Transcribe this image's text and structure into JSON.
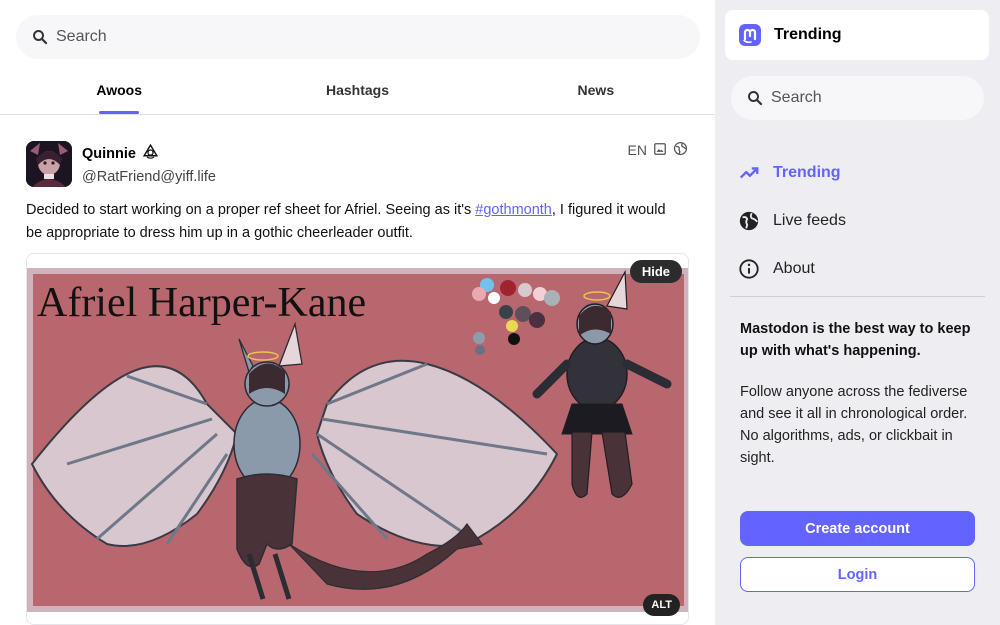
{
  "search": {
    "placeholder": "Search"
  },
  "tabs": [
    {
      "label": "Awoos",
      "active": true
    },
    {
      "label": "Hashtags",
      "active": false
    },
    {
      "label": "News",
      "active": false
    }
  ],
  "post": {
    "display_name": "Quinnie",
    "handle": "@RatFriend@yiff.life",
    "language": "EN",
    "text_before": "Decided to start working on a proper ref sheet for Afriel. Seeing as it's ",
    "hashtag": "#gothmonth",
    "text_after": ", I figured it would be appropriate to dress him up in a gothic cheerleader outfit.",
    "media": {
      "title_text": "Afriel Harper-Kane",
      "hide_label": "Hide",
      "alt_label": "ALT"
    }
  },
  "sidebar": {
    "brand_title": "Trending",
    "search_placeholder": "Search",
    "nav": [
      {
        "label": "Trending",
        "icon": "trending-icon",
        "active": true
      },
      {
        "label": "Live feeds",
        "icon": "globe-icon",
        "active": false
      },
      {
        "label": "About",
        "icon": "info-icon",
        "active": false
      }
    ],
    "pitch_strong": "Mastodon is the best way to keep up with what's happening.",
    "pitch": "Follow anyone across the fediverse and see it all in chronological order. No algorithms, ads, or clickbait in sight.",
    "create_account_label": "Create account",
    "login_label": "Login"
  },
  "colors": {
    "accent": "#6364ff",
    "sidebar_bg": "#eeeef2",
    "artwork_bg": "#b9676f"
  }
}
